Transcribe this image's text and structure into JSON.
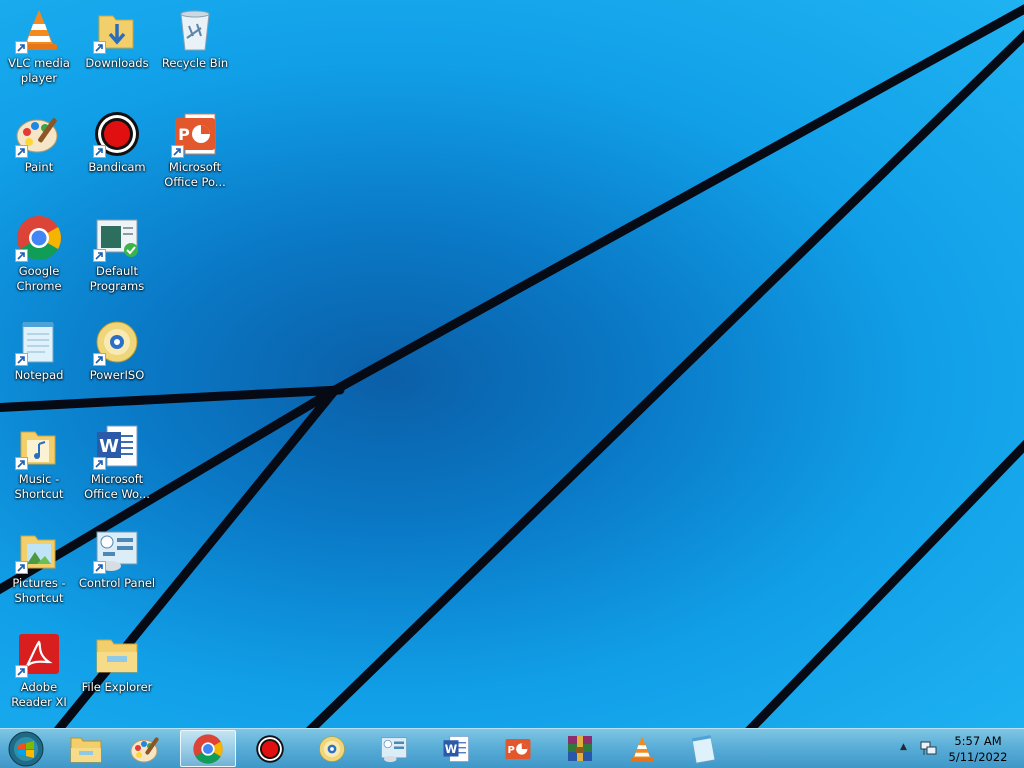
{
  "desktop": {
    "icons": [
      {
        "label": "VLC media player",
        "icon": "vlc-icon"
      },
      {
        "label": "Downloads",
        "icon": "downloads-folder-icon"
      },
      {
        "label": "Recycle Bin",
        "icon": "recycle-bin-icon"
      },
      {
        "label": "Paint",
        "icon": "paint-icon"
      },
      {
        "label": "Bandicam",
        "icon": "bandicam-icon"
      },
      {
        "label": "Microsoft Office Po...",
        "icon": "powerpoint-icon"
      },
      {
        "label": "Google Chrome",
        "icon": "chrome-icon"
      },
      {
        "label": "Default Programs",
        "icon": "default-programs-icon"
      },
      {
        "label": "Notepad",
        "icon": "notepad-icon"
      },
      {
        "label": "PowerISO",
        "icon": "poweriso-icon"
      },
      {
        "label": "Music - Shortcut",
        "icon": "music-folder-icon"
      },
      {
        "label": "Microsoft Office Wo...",
        "icon": "word-icon"
      },
      {
        "label": "Pictures - Shortcut",
        "icon": "pictures-folder-icon"
      },
      {
        "label": "Control Panel",
        "icon": "control-panel-icon"
      },
      {
        "label": "Adobe Reader XI",
        "icon": "adobe-reader-icon"
      },
      {
        "label": "File Explorer",
        "icon": "file-explorer-icon"
      }
    ]
  },
  "taskbar": {
    "items": [
      {
        "name": "file-explorer",
        "icon": "file-explorer-icon"
      },
      {
        "name": "paint",
        "icon": "paint-icon"
      },
      {
        "name": "chrome",
        "icon": "chrome-icon",
        "active": true
      },
      {
        "name": "bandicam",
        "icon": "bandicam-icon"
      },
      {
        "name": "poweriso",
        "icon": "poweriso-icon"
      },
      {
        "name": "control-panel",
        "icon": "control-panel-icon"
      },
      {
        "name": "word",
        "icon": "word-icon"
      },
      {
        "name": "powerpoint",
        "icon": "powerpoint-icon"
      },
      {
        "name": "winrar",
        "icon": "winrar-icon"
      },
      {
        "name": "vlc",
        "icon": "vlc-icon"
      },
      {
        "name": "notepad",
        "icon": "notepad-icon"
      }
    ],
    "clock": {
      "time": "5:57 AM",
      "date": "5/11/2022"
    },
    "tray": {
      "show_hidden": "▲",
      "network_icon": "network-icon"
    }
  },
  "colors": {
    "wallpaper": "#0a86d4",
    "taskbar": "#5aaed8"
  }
}
